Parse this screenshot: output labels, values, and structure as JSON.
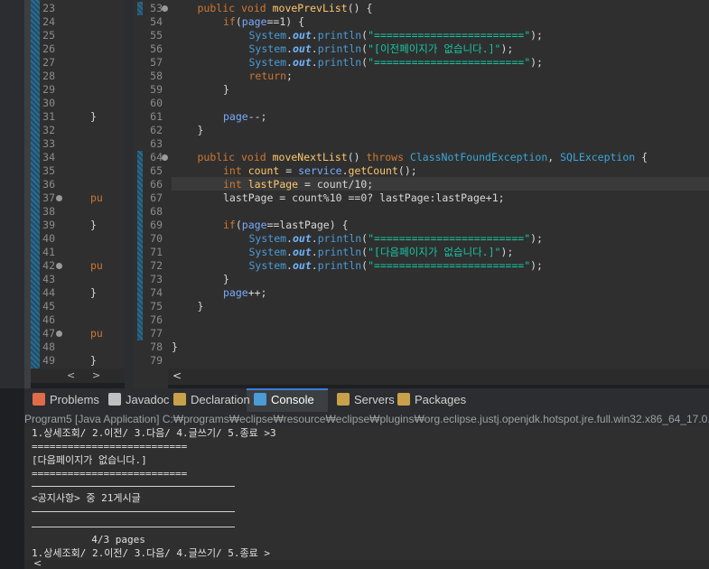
{
  "left_editor": {
    "lines": [
      {
        "num": "23",
        "code": ""
      },
      {
        "num": "24",
        "code": ""
      },
      {
        "num": "25",
        "code": ""
      },
      {
        "num": "26",
        "code": ""
      },
      {
        "num": "27",
        "code": ""
      },
      {
        "num": "28",
        "code": ""
      },
      {
        "num": "29",
        "code": ""
      },
      {
        "num": "30",
        "code": ""
      },
      {
        "num": "31",
        "code": "}"
      },
      {
        "num": "32",
        "code": ""
      },
      {
        "num": "33",
        "code": ""
      },
      {
        "num": "34",
        "code": ""
      },
      {
        "num": "35",
        "code": ""
      },
      {
        "num": "36",
        "code": ""
      },
      {
        "num": "37",
        "code": "pu",
        "fold": true
      },
      {
        "num": "38",
        "code": ""
      },
      {
        "num": "39",
        "code": "}"
      },
      {
        "num": "40",
        "code": ""
      },
      {
        "num": "41",
        "code": ""
      },
      {
        "num": "42",
        "code": "pu",
        "fold": true
      },
      {
        "num": "43",
        "code": ""
      },
      {
        "num": "44",
        "code": "}"
      },
      {
        "num": "45",
        "code": ""
      },
      {
        "num": "46",
        "code": ""
      },
      {
        "num": "47",
        "code": "pu",
        "fold": true
      },
      {
        "num": "48",
        "code": ""
      },
      {
        "num": "49",
        "code": "}"
      }
    ],
    "scroll_left_glyph": "<",
    "scroll_right_glyph": ">",
    "scroll_down_glyph": "⌄"
  },
  "main_editor": {
    "lines": [
      {
        "num": "53",
        "fold": true,
        "html_tokens": [
          [
            "kw",
            "public "
          ],
          [
            "kw",
            "void "
          ],
          [
            "fn",
            "movePrevList"
          ],
          [
            "dfl",
            "() {"
          ]
        ],
        "indent": 1
      },
      {
        "num": "54",
        "html_tokens": [
          [
            "kw",
            "if"
          ],
          [
            "dfl",
            "("
          ],
          [
            "var",
            "page"
          ],
          [
            "dfl",
            "==1) {"
          ]
        ],
        "indent": 2
      },
      {
        "num": "55",
        "html_tokens": [
          [
            "sys",
            "System"
          ],
          [
            "dfl",
            "."
          ],
          [
            "out",
            "out"
          ],
          [
            "dfl",
            "."
          ],
          [
            "sys",
            "println"
          ],
          [
            "dfl",
            "("
          ],
          [
            "str",
            "\"========================\""
          ],
          [
            "dfl",
            ");"
          ]
        ],
        "indent": 3
      },
      {
        "num": "56",
        "html_tokens": [
          [
            "sys",
            "System"
          ],
          [
            "dfl",
            "."
          ],
          [
            "out",
            "out"
          ],
          [
            "dfl",
            "."
          ],
          [
            "sys",
            "println"
          ],
          [
            "dfl",
            "("
          ],
          [
            "str",
            "\"[이전페이지가 없습니다.]\""
          ],
          [
            "dfl",
            ");"
          ]
        ],
        "indent": 3
      },
      {
        "num": "57",
        "html_tokens": [
          [
            "sys",
            "System"
          ],
          [
            "dfl",
            "."
          ],
          [
            "out",
            "out"
          ],
          [
            "dfl",
            "."
          ],
          [
            "sys",
            "println"
          ],
          [
            "dfl",
            "("
          ],
          [
            "str",
            "\"========================\""
          ],
          [
            "dfl",
            ");"
          ]
        ],
        "indent": 3
      },
      {
        "num": "58",
        "html_tokens": [
          [
            "kw",
            "return"
          ],
          [
            "dfl",
            ";"
          ]
        ],
        "indent": 3
      },
      {
        "num": "59",
        "html_tokens": [
          [
            "dfl",
            "}"
          ]
        ],
        "indent": 2
      },
      {
        "num": "60",
        "html_tokens": [],
        "indent": 0
      },
      {
        "num": "61",
        "html_tokens": [
          [
            "var",
            "page"
          ],
          [
            "dfl",
            "--;"
          ]
        ],
        "indent": 2
      },
      {
        "num": "62",
        "html_tokens": [
          [
            "dfl",
            "}"
          ]
        ],
        "indent": 1
      },
      {
        "num": "63",
        "html_tokens": [],
        "indent": 0
      },
      {
        "num": "64",
        "fold": true,
        "html_tokens": [
          [
            "kw",
            "public "
          ],
          [
            "kw",
            "void "
          ],
          [
            "fn",
            "moveNextList"
          ],
          [
            "dfl",
            "() "
          ],
          [
            "kw",
            "throws "
          ],
          [
            "typ",
            "ClassNotFoundException"
          ],
          [
            "dfl",
            ", "
          ],
          [
            "typ",
            "SQLException"
          ],
          [
            "dfl",
            " {"
          ]
        ],
        "indent": 1
      },
      {
        "num": "65",
        "html_tokens": [
          [
            "kw",
            "int "
          ],
          [
            "fn",
            "count"
          ],
          [
            "dfl",
            " = "
          ],
          [
            "var",
            "service"
          ],
          [
            "dfl",
            "."
          ],
          [
            "fn",
            "getCount"
          ],
          [
            "dfl",
            "();"
          ]
        ],
        "indent": 2
      },
      {
        "num": "66",
        "html_tokens": [
          [
            "kw",
            "int "
          ],
          [
            "fn",
            "lastPage"
          ],
          [
            "dfl",
            " = count/10;"
          ]
        ],
        "indent": 2
      },
      {
        "num": "67",
        "html_tokens": [
          [
            "dfl",
            "lastPage = count%10 ==0? lastPage:lastPage+1;"
          ]
        ],
        "indent": 2
      },
      {
        "num": "68",
        "html_tokens": [],
        "indent": 0
      },
      {
        "num": "69",
        "html_tokens": [
          [
            "kw",
            "if"
          ],
          [
            "dfl",
            "("
          ],
          [
            "var",
            "page"
          ],
          [
            "dfl",
            "==lastPage) {"
          ]
        ],
        "indent": 2
      },
      {
        "num": "70",
        "html_tokens": [
          [
            "sys",
            "System"
          ],
          [
            "dfl",
            "."
          ],
          [
            "out",
            "out"
          ],
          [
            "dfl",
            "."
          ],
          [
            "sys",
            "println"
          ],
          [
            "dfl",
            "("
          ],
          [
            "str",
            "\"========================\""
          ],
          [
            "dfl",
            ");"
          ]
        ],
        "indent": 3
      },
      {
        "num": "71",
        "html_tokens": [
          [
            "sys",
            "System"
          ],
          [
            "dfl",
            "."
          ],
          [
            "out",
            "out"
          ],
          [
            "dfl",
            "."
          ],
          [
            "sys",
            "println"
          ],
          [
            "dfl",
            "("
          ],
          [
            "str",
            "\"[다음페이지가 없습니다.]\""
          ],
          [
            "dfl",
            ");"
          ]
        ],
        "indent": 3
      },
      {
        "num": "72",
        "html_tokens": [
          [
            "sys",
            "System"
          ],
          [
            "dfl",
            "."
          ],
          [
            "out",
            "out"
          ],
          [
            "dfl",
            "."
          ],
          [
            "sys",
            "println"
          ],
          [
            "dfl",
            "("
          ],
          [
            "str",
            "\"========================\""
          ],
          [
            "dfl",
            ");"
          ]
        ],
        "indent": 3
      },
      {
        "num": "73",
        "html_tokens": [
          [
            "dfl",
            "}"
          ]
        ],
        "indent": 2
      },
      {
        "num": "74",
        "html_tokens": [
          [
            "var",
            "page"
          ],
          [
            "dfl",
            "++;"
          ]
        ],
        "indent": 2
      },
      {
        "num": "75",
        "html_tokens": [
          [
            "dfl",
            "}"
          ]
        ],
        "indent": 1
      },
      {
        "num": "76",
        "html_tokens": [],
        "indent": 0
      },
      {
        "num": "77",
        "html_tokens": [],
        "indent": 0
      },
      {
        "num": "78",
        "html_tokens": [
          [
            "dfl",
            "}"
          ]
        ],
        "indent": 0
      },
      {
        "num": "79",
        "html_tokens": [],
        "indent": 0
      }
    ],
    "scroll_left_glyph": "<"
  },
  "tabs": [
    {
      "label": "Problems",
      "icon": "problems-icon",
      "color": "#e06c4a"
    },
    {
      "label": "Javadoc",
      "icon": "at-sign-icon",
      "color": "#c0c0c0"
    },
    {
      "label": "Declaration",
      "icon": "declaration-icon",
      "color": "#c8a24a"
    },
    {
      "label": "Console",
      "icon": "console-icon",
      "color": "#4a9bd6",
      "active": true
    },
    {
      "label": "Servers",
      "icon": "servers-icon",
      "color": "#c8a24a"
    },
    {
      "label": "Packages",
      "icon": "packages-icon",
      "color": "#c8a24a"
    }
  ],
  "console": {
    "header": "Program5 [Java Application] C:₩programs₩eclipse₩resource₩eclipse₩plugins₩org.eclipse.justj.openjdk.hotspot.jre.full.win32.x86_64_17.0.2",
    "lines": [
      "1.상세조회/ 2.이전/ 3.다음/ 4.글쓰기/ 5.종료 >3",
      "==========================",
      "[다음페이지가 없습니다.]",
      "==========================",
      "",
      "<공지사항> 중 21게시글",
      "",
      "",
      "          4/3 pages",
      "1.상세조회/ 2.이전/ 3.다음/ 4.글쓰기/ 5.종료 >"
    ],
    "scroll_left_glyph": "<"
  }
}
